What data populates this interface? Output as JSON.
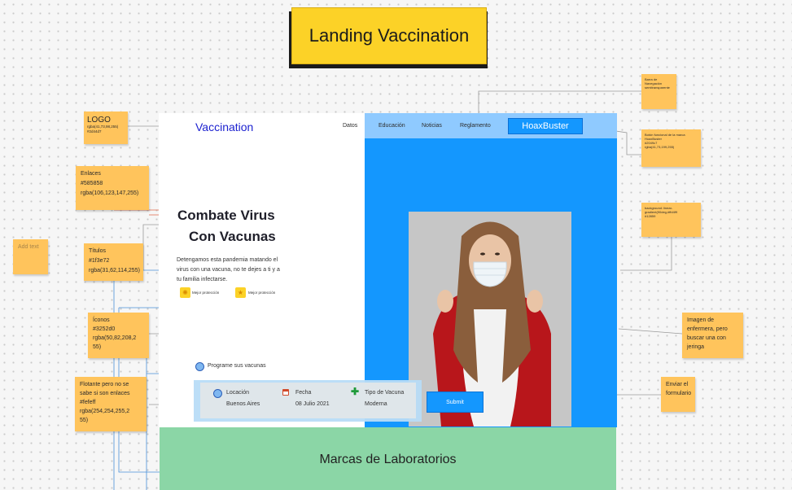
{
  "board": {
    "title": "Landing Vaccination"
  },
  "notes": {
    "logo": {
      "title": "LOGO",
      "body": "rgba(41,73,98,255)\n#2d44d7",
      "foot": ""
    },
    "enlaces": {
      "body": "Enlaces\n#585858\nrgba(106,123,147,255)",
      "foot": ""
    },
    "add_text": {
      "body": "Add text"
    },
    "titulos": {
      "body": "Títulos\n#1f3e72\nrgba(31,62,114,255)",
      "foot": ""
    },
    "iconos": {
      "body": "Íconos\n#3252d0\nrgba(50,82,208,2\n55)",
      "foot": ""
    },
    "flotante": {
      "body": "Flotante pero no se\nsabe si son enlaces\n#fefeff\nrgba(254,254,255,2\n55)",
      "foot": ""
    },
    "barra_nav": {
      "body": "Barra de\nNavegación\nsemitransparente",
      "foot": ""
    },
    "boton_marca": {
      "body": "Botón funcional de la marca\nHoaxBuster\n#2049c7\nrgba(41,73,199,255)",
      "foot": ""
    },
    "background": {
      "body": "background: linear-\ngradient(90deg,#ffd4f9\n#12859",
      "foot": ""
    },
    "imagen": {
      "body": "Imagen de\nenfermera, pero\nbuscar una con\njeringa",
      "foot": ""
    },
    "enviar": {
      "body": "Enviar el\nformulario",
      "foot": ""
    }
  },
  "landing": {
    "logo": "Vaccination",
    "nav": [
      "Datos",
      "Educación",
      "Noticias",
      "Reglamento"
    ],
    "cta_brand": "HoaxBuster",
    "headline_1": "Combate Virus",
    "headline_2": "Con Vacunas",
    "paragraph": "Detengamos esta pandemia matando el virus con una vacuna, no te dejes a ti y a tu familia infectarse.",
    "features": [
      {
        "label": "Mejor protección",
        "icon": "sun-icon"
      },
      {
        "label": "Mejor protección",
        "icon": "star-icon"
      }
    ],
    "schedule_label": "Programe sus vacunas",
    "form": {
      "location_label": "Locación",
      "location_value": "Buenos Aires",
      "date_label": "Fecha",
      "date_value": "08 Julio 2021",
      "vaccine_label": "Tipo de Vacuna",
      "vaccine_value": "Moderna",
      "submit_label": "Submit"
    },
    "labs_title": "Marcas de Laboratorios"
  },
  "colors": {
    "logo": "#1d22d0",
    "hero_blue": "#1497fe",
    "nav_overlay": "#8fcaff",
    "title_yellow": "#fcd227",
    "note_orange": "#ffc45c",
    "labs_green": "#8bd6a6",
    "connector_blue": "#4a90d9",
    "connector_red": "#e06a4c"
  }
}
